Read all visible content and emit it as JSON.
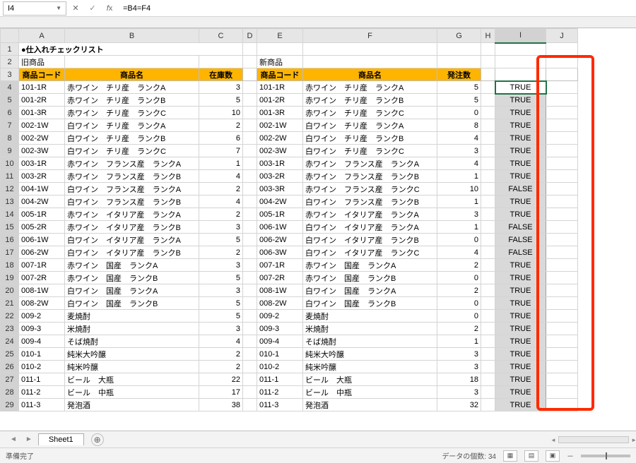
{
  "name_box": "I4",
  "formula": "=B4=F4",
  "sheet_name": "Sheet1",
  "status_ready": "準備完了",
  "status_count_label": "データの個数:",
  "status_count": 34,
  "title": "●仕入れチェックリスト",
  "sub_left": "旧商品",
  "sub_right": "新商品",
  "headers": {
    "code": "商品コード",
    "name": "商品名",
    "stock": "在庫数",
    "order": "発注数"
  },
  "rows": [
    {
      "n": 4,
      "lc": "101-1R",
      "ln": "赤ワイン　チリ産　ランクA",
      "ls": 3,
      "rc": "101-1R",
      "rn": "赤ワイン　チリ産　ランクA",
      "rs": 5,
      "r": "TRUE"
    },
    {
      "n": 5,
      "lc": "001-2R",
      "ln": "赤ワイン　チリ産　ランクB",
      "ls": 5,
      "rc": "001-2R",
      "rn": "赤ワイン　チリ産　ランクB",
      "rs": 5,
      "r": "TRUE"
    },
    {
      "n": 6,
      "lc": "001-3R",
      "ln": "赤ワイン　チリ産　ランクC",
      "ls": 10,
      "rc": "001-3R",
      "rn": "赤ワイン　チリ産　ランクC",
      "rs": 0,
      "r": "TRUE"
    },
    {
      "n": 7,
      "lc": "002-1W",
      "ln": "白ワイン　チリ産　ランクA",
      "ls": 2,
      "rc": "002-1W",
      "rn": "白ワイン　チリ産　ランクA",
      "rs": 8,
      "r": "TRUE"
    },
    {
      "n": 8,
      "lc": "002-2W",
      "ln": "白ワイン　チリ産　ランクB",
      "ls": 6,
      "rc": "002-2W",
      "rn": "白ワイン　チリ産　ランクB",
      "rs": 4,
      "r": "TRUE"
    },
    {
      "n": 9,
      "lc": "002-3W",
      "ln": "白ワイン　チリ産　ランクC",
      "ls": 7,
      "rc": "002-3W",
      "rn": "白ワイン　チリ産　ランクC",
      "rs": 3,
      "r": "TRUE"
    },
    {
      "n": 10,
      "lc": "003-1R",
      "ln": "赤ワイン　フランス産　ランクA",
      "ls": 1,
      "rc": "003-1R",
      "rn": "赤ワイン　フランス産　ランクA",
      "rs": 4,
      "r": "TRUE"
    },
    {
      "n": 11,
      "lc": "003-2R",
      "ln": "赤ワイン　フランス産　ランクB",
      "ls": 4,
      "rc": "003-2R",
      "rn": "赤ワイン　フランス産　ランクB",
      "rs": 1,
      "r": "TRUE"
    },
    {
      "n": 12,
      "lc": "004-1W",
      "ln": "白ワイン　フランス産　ランクA",
      "ls": 2,
      "rc": "003-3R",
      "rn": "赤ワイン　フランス産　ランクC",
      "rs": 10,
      "r": "FALSE"
    },
    {
      "n": 13,
      "lc": "004-2W",
      "ln": "白ワイン　フランス産　ランクB",
      "ls": 4,
      "rc": "004-2W",
      "rn": "白ワイン　フランス産　ランクB",
      "rs": 1,
      "r": "TRUE"
    },
    {
      "n": 14,
      "lc": "005-1R",
      "ln": "赤ワイン　イタリア産　ランクA",
      "ls": 2,
      "rc": "005-1R",
      "rn": "赤ワイン　イタリア産　ランクA",
      "rs": 3,
      "r": "TRUE"
    },
    {
      "n": 15,
      "lc": "005-2R",
      "ln": "赤ワイン　イタリア産　ランクB",
      "ls": 3,
      "rc": "006-1W",
      "rn": "白ワイン　イタリア産　ランクA",
      "rs": 1,
      "r": "FALSE"
    },
    {
      "n": 16,
      "lc": "006-1W",
      "ln": "白ワイン　イタリア産　ランクA",
      "ls": 5,
      "rc": "006-2W",
      "rn": "白ワイン　イタリア産　ランクB",
      "rs": 0,
      "r": "FALSE"
    },
    {
      "n": 17,
      "lc": "006-2W",
      "ln": "白ワイン　イタリア産　ランクB",
      "ls": 2,
      "rc": "006-3W",
      "rn": "白ワイン　イタリア産　ランクC",
      "rs": 4,
      "r": "FALSE"
    },
    {
      "n": 18,
      "lc": "007-1R",
      "ln": "赤ワイン　国産　ランクA",
      "ls": 3,
      "rc": "007-1R",
      "rn": "赤ワイン　国産　ランクA",
      "rs": 2,
      "r": "TRUE"
    },
    {
      "n": 19,
      "lc": "007-2R",
      "ln": "赤ワイン　国産　ランクB",
      "ls": 5,
      "rc": "007-2R",
      "rn": "赤ワイン　国産　ランクB",
      "rs": 0,
      "r": "TRUE"
    },
    {
      "n": 20,
      "lc": "008-1W",
      "ln": "白ワイン　国産　ランクA",
      "ls": 3,
      "rc": "008-1W",
      "rn": "白ワイン　国産　ランクA",
      "rs": 2,
      "r": "TRUE"
    },
    {
      "n": 21,
      "lc": "008-2W",
      "ln": "白ワイン　国産　ランクB",
      "ls": 5,
      "rc": "008-2W",
      "rn": "白ワイン　国産　ランクB",
      "rs": 0,
      "r": "TRUE"
    },
    {
      "n": 22,
      "lc": "009-2",
      "ln": "麦焼酎",
      "ls": 5,
      "rc": "009-2",
      "rn": "麦焼酎",
      "rs": 0,
      "r": "TRUE"
    },
    {
      "n": 23,
      "lc": "009-3",
      "ln": "米焼酎",
      "ls": 3,
      "rc": "009-3",
      "rn": "米焼酎",
      "rs": 2,
      "r": "TRUE"
    },
    {
      "n": 24,
      "lc": "009-4",
      "ln": "そば焼酎",
      "ls": 4,
      "rc": "009-4",
      "rn": "そば焼酎",
      "rs": 1,
      "r": "TRUE"
    },
    {
      "n": 25,
      "lc": "010-1",
      "ln": "純米大吟醸",
      "ls": 2,
      "rc": "010-1",
      "rn": "純米大吟醸",
      "rs": 3,
      "r": "TRUE"
    },
    {
      "n": 26,
      "lc": "010-2",
      "ln": "純米吟醸",
      "ls": 2,
      "rc": "010-2",
      "rn": "純米吟醸",
      "rs": 3,
      "r": "TRUE"
    },
    {
      "n": 27,
      "lc": "011-1",
      "ln": "ビール　大瓶",
      "ls": 22,
      "rc": "011-1",
      "rn": "ビール　大瓶",
      "rs": 18,
      "r": "TRUE"
    },
    {
      "n": 28,
      "lc": "011-2",
      "ln": "ビール　中瓶",
      "ls": 17,
      "rc": "011-2",
      "rn": "ビール　中瓶",
      "rs": 3,
      "r": "TRUE"
    },
    {
      "n": 29,
      "lc": "011-3",
      "ln": "発泡酒",
      "ls": 38,
      "rc": "011-3",
      "rn": "発泡酒",
      "rs": 32,
      "r": "TRUE"
    }
  ]
}
